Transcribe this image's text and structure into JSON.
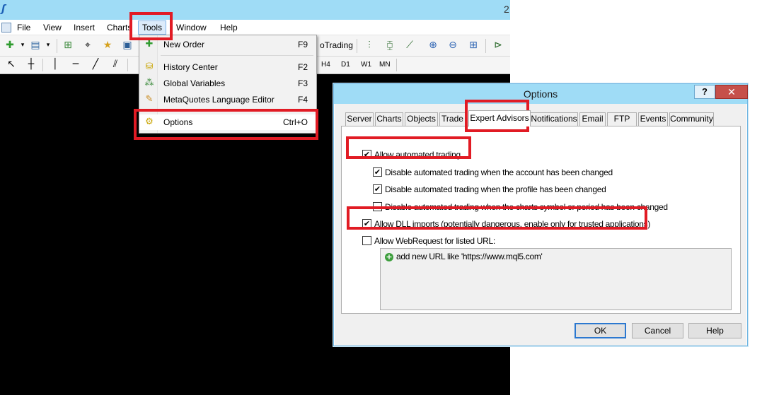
{
  "app": {
    "title_fragment": "2",
    "menu": [
      "File",
      "View",
      "Insert",
      "Charts",
      "Tools",
      "Window",
      "Help"
    ],
    "toolbar": {
      "autotrading_label": "AutoTrading",
      "autotrading_visible": "oTrading"
    },
    "timeframes": [
      "H4",
      "D1",
      "W1",
      "MN"
    ]
  },
  "tools_menu": {
    "items": [
      {
        "label": "New Order",
        "shortcut": "F9",
        "icon": "new-order-icon"
      },
      {
        "label": "History Center",
        "shortcut": "F2",
        "icon": "history-center-icon"
      },
      {
        "label": "Global Variables",
        "shortcut": "F3",
        "icon": "global-variables-icon"
      },
      {
        "label": "MetaQuotes Language Editor",
        "shortcut": "F4",
        "icon": "metaeditor-icon"
      },
      {
        "label": "Options",
        "shortcut": "Ctrl+O",
        "icon": "options-icon"
      }
    ]
  },
  "dialog": {
    "title": "Options",
    "help_label": "?",
    "close_label": "✕",
    "tabs": [
      "Server",
      "Charts",
      "Objects",
      "Trade",
      "Expert Advisors",
      "Notifications",
      "Email",
      "FTP",
      "Events",
      "Community"
    ],
    "active_tab": "Expert Advisors",
    "options": {
      "allow_automated_trading": {
        "label": "Allow automated trading",
        "checked": true
      },
      "disable_on_account_change": {
        "label": "Disable automated trading when the account has been changed",
        "checked": true
      },
      "disable_on_profile_change": {
        "label": "Disable automated trading when the profile has been changed",
        "checked": true
      },
      "disable_on_symbol_change": {
        "label": "Disable automated trading when the charts symbol or period has been changed",
        "checked": false
      },
      "allow_dll_imports": {
        "label": "Allow DLL imports (potentially dangerous, enable only for trusted applications)",
        "checked": true
      },
      "allow_webrequest": {
        "label": "Allow WebRequest for listed URL:",
        "checked": false
      }
    },
    "url_list": {
      "add_text": "add new URL like 'https://www.mql5.com'"
    },
    "buttons": {
      "ok": "OK",
      "cancel": "Cancel",
      "help": "Help"
    }
  },
  "colors": {
    "highlight": "#e11b24",
    "titlebar": "#9fdcf6",
    "close": "#c6504a"
  }
}
